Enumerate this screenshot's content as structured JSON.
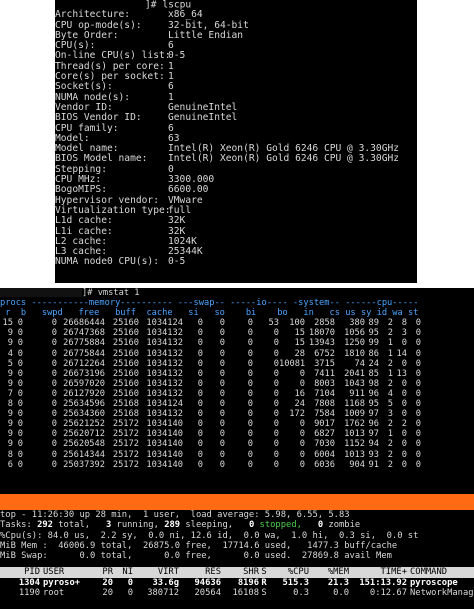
{
  "lscpu": {
    "prompt_suffix": "]# lscpu",
    "rows": [
      {
        "key": "Architecture:",
        "value": "x86_64"
      },
      {
        "key": "CPU op-mode(s):",
        "value": "32-bit, 64-bit"
      },
      {
        "key": "Byte Order:",
        "value": "Little Endian"
      },
      {
        "key": "CPU(s):",
        "value": "6"
      },
      {
        "key": "On-line CPU(s) list:",
        "value": "0-5"
      },
      {
        "key": "Thread(s) per core:",
        "value": "1"
      },
      {
        "key": "Core(s) per socket:",
        "value": "1"
      },
      {
        "key": "Socket(s):",
        "value": "6"
      },
      {
        "key": "NUMA node(s):",
        "value": "1"
      },
      {
        "key": "Vendor ID:",
        "value": "GenuineIntel"
      },
      {
        "key": "BIOS Vendor ID:",
        "value": "GenuineIntel"
      },
      {
        "key": "CPU family:",
        "value": "6"
      },
      {
        "key": "Model:",
        "value": "63"
      },
      {
        "key": "Model name:",
        "value": "Intel(R) Xeon(R) Gold 6246 CPU @ 3.30GHz"
      },
      {
        "key": "BIOS Model name:",
        "value": "Intel(R) Xeon(R) Gold 6246 CPU @ 3.30GHz"
      },
      {
        "key": "Stepping:",
        "value": "0"
      },
      {
        "key": "CPU MHz:",
        "value": "3300.000"
      },
      {
        "key": "BogoMIPS:",
        "value": "6600.00"
      },
      {
        "key": "Hypervisor vendor:",
        "value": "VMware"
      },
      {
        "key": "Virtualization type:",
        "value": "full"
      },
      {
        "key": "L1d cache:",
        "value": "32K"
      },
      {
        "key": "L1i cache:",
        "value": "32K"
      },
      {
        "key": "L2 cache:",
        "value": "1024K"
      },
      {
        "key": "L3 cache:",
        "value": "25344K"
      },
      {
        "key": "NUMA node0 CPU(s):",
        "value": "0-5"
      }
    ]
  },
  "vmstat": {
    "prompt_suffix": "]# vmstat 1",
    "header1": "procs -----------memory---------- ---swap-- -----io---- -system-- ------cpu-----",
    "header2": " r  b   swpd   free   buff  cache   si   so    bi    bo   in   cs us sy id wa st",
    "rows": [
      [
        "15",
        "0",
        "0",
        "26686444",
        "25160",
        "1034124",
        "0",
        "0",
        "0",
        "53",
        "100",
        "2858",
        "380",
        "89",
        "2",
        "8",
        "0"
      ],
      [
        "9",
        "0",
        "0",
        "26747368",
        "25160",
        "1034132",
        "0",
        "0",
        "0",
        "0",
        "15",
        "18070",
        "1056",
        "95",
        "2",
        "3",
        "0"
      ],
      [
        "9",
        "0",
        "0",
        "26775884",
        "25160",
        "1034132",
        "0",
        "0",
        "0",
        "0",
        "15",
        "13943",
        "1250",
        "99",
        "1",
        "0",
        "0"
      ],
      [
        "4",
        "0",
        "0",
        "26775844",
        "25160",
        "1034132",
        "0",
        "0",
        "0",
        "0",
        "28",
        "6752",
        "1810",
        "86",
        "1",
        "14",
        "0"
      ],
      [
        "5",
        "0",
        "0",
        "26712264",
        "25160",
        "1034132",
        "0",
        "0",
        "0",
        "0",
        "10081",
        "3715",
        "74",
        "24",
        "2",
        "0",
        "0"
      ],
      [
        "9",
        "0",
        "0",
        "26673196",
        "25160",
        "1034132",
        "0",
        "0",
        "0",
        "0",
        "0",
        "7411",
        "2041",
        "85",
        "1",
        "13",
        "0"
      ],
      [
        "9",
        "0",
        "0",
        "26597020",
        "25160",
        "1034132",
        "0",
        "0",
        "0",
        "0",
        "0",
        "8003",
        "1043",
        "98",
        "2",
        "0",
        "0"
      ],
      [
        "7",
        "0",
        "0",
        "26127920",
        "25160",
        "1034132",
        "0",
        "0",
        "0",
        "0",
        "16",
        "7104",
        "911",
        "96",
        "4",
        "0",
        "0"
      ],
      [
        "8",
        "0",
        "0",
        "25634596",
        "25168",
        "1034124",
        "0",
        "0",
        "0",
        "0",
        "24",
        "7808",
        "1168",
        "95",
        "5",
        "0",
        "0"
      ],
      [
        "9",
        "0",
        "0",
        "25634360",
        "25168",
        "1034132",
        "0",
        "0",
        "0",
        "0",
        "172",
        "7584",
        "1009",
        "97",
        "3",
        "0",
        "0"
      ],
      [
        "9",
        "0",
        "0",
        "25621252",
        "25172",
        "1034140",
        "0",
        "0",
        "0",
        "0",
        "0",
        "9017",
        "1762",
        "96",
        "2",
        "2",
        "0"
      ],
      [
        "9",
        "0",
        "0",
        "25620712",
        "25172",
        "1034140",
        "0",
        "0",
        "0",
        "0",
        "0",
        "6827",
        "1013",
        "97",
        "1",
        "0",
        "0"
      ],
      [
        "9",
        "0",
        "0",
        "25620548",
        "25172",
        "1034140",
        "0",
        "0",
        "0",
        "0",
        "0",
        "7030",
        "1152",
        "94",
        "2",
        "0",
        "0"
      ],
      [
        "8",
        "0",
        "0",
        "25614344",
        "25172",
        "1034140",
        "0",
        "0",
        "0",
        "0",
        "0",
        "6004",
        "1013",
        "93",
        "2",
        "0",
        "0"
      ],
      [
        "6",
        "0",
        "0",
        "25037392",
        "25172",
        "1034140",
        "0",
        "0",
        "0",
        "0",
        "0",
        "6036",
        "904",
        "91",
        "2",
        "0",
        "0"
      ]
    ]
  },
  "top": {
    "line1": "top - 11:26:30 up 28 min,  1 user,  load average: 5.98, 6.55, 5.83",
    "tasks_prefix": "Tasks: ",
    "tasks_total": "292",
    "tasks_mid1": " total,   ",
    "tasks_running": "3",
    "tasks_mid2": " running, ",
    "tasks_sleeping": "289",
    "tasks_mid3": " sleeping,   ",
    "tasks_stopped": "0",
    "tasks_mid4": " stopped,   ",
    "tasks_zombie": "0",
    "tasks_end": " zombie",
    "cpu_line": "%Cpu(s): 84.0 us,  2.2 sy,  0.0 ni, 12.6 id,  0.0 wa,  1.0 hi,  0.3 si,  0.0 st",
    "mem_line": "MiB Mem :  46006.9 total,  26875.0 free,  17714.6 used,   1477.3 buff/cache",
    "swap_line": "MiB Swap:      0.0 total,      0.0 free,      0.0 used.  27869.8 avail Mem",
    "columns": [
      "PID",
      "USER",
      "PR",
      "NI",
      "VIRT",
      "RES",
      "SHR",
      "S",
      "%CPU",
      "%MEM",
      "TIME+",
      "COMMAND"
    ],
    "processes": [
      [
        "1304",
        "pyroso+",
        "20",
        "0",
        "33.6g",
        "94636",
        "8196",
        "R",
        "515.3",
        "21.3",
        "151:13.92",
        "pyroscope"
      ],
      [
        "1190",
        "root",
        "20",
        "0",
        "380712",
        "20564",
        "16108",
        "S",
        "0.3",
        "0.0",
        "0:12.67",
        "NetworkManager"
      ]
    ]
  }
}
